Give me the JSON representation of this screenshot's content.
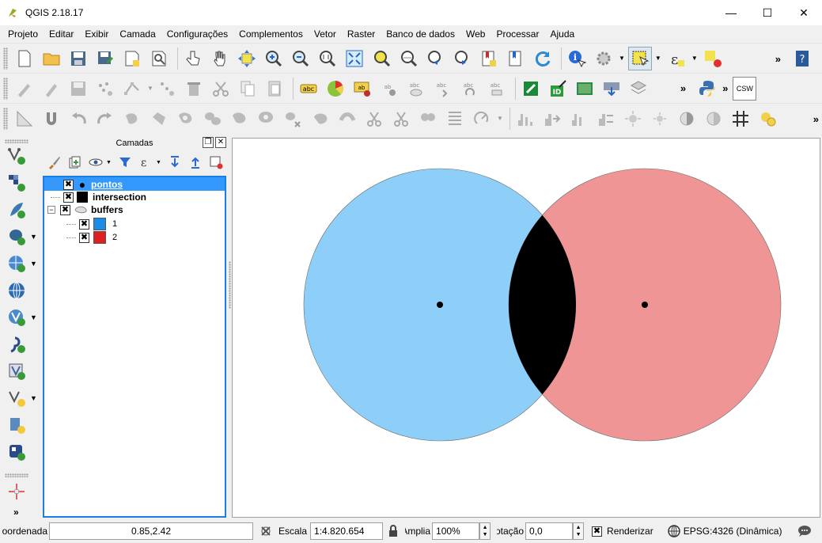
{
  "window": {
    "title": "QGIS 2.18.17",
    "minimize": "—",
    "maximize": "☐",
    "close": "✕"
  },
  "menu": [
    "Projeto",
    "Editar",
    "Exibir",
    "Camada",
    "Configurações",
    "Complementos",
    "Vetor",
    "Raster",
    "Banco de dados",
    "Web",
    "Processar",
    "Ajuda"
  ],
  "toolbars": {
    "more": "»",
    "csw_label": "CSW"
  },
  "layers_panel": {
    "title": "Camadas",
    "layers": [
      {
        "name": "pontos",
        "checked": "✖",
        "selected": true
      },
      {
        "name": "intersection",
        "checked": "✖",
        "swatch": "#000000"
      },
      {
        "name": "buffers",
        "checked": "✖",
        "expander": "−"
      }
    ],
    "categories": [
      {
        "label": "1",
        "checked": "✖",
        "swatch": "#1a8ce8"
      },
      {
        "label": "2",
        "checked": "✖",
        "swatch": "#e02020"
      }
    ]
  },
  "map": {
    "background": "#ffffff",
    "buffer1_color": "#8ecffa",
    "buffer2_color": "#ef9595",
    "intersection_color": "#000000",
    "point_color": "#000000"
  },
  "status": {
    "coord_label": "Coordenada",
    "coord_value": "0.85,2.42",
    "scale_label": "Escala",
    "scale_value": "1:4.820.654",
    "magnifier_label": "Amplia",
    "magnifier_value": "100%",
    "rotation_label": "Rotação",
    "rotation_value": "0,0",
    "render_label": "Renderizar",
    "render_checked": "✖",
    "crs": "EPSG:4326 (Dinâmica)"
  }
}
